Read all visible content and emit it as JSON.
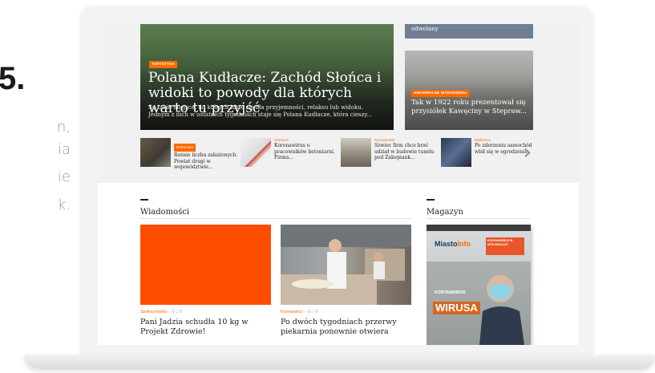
{
  "side_text": {
    "number": "5.",
    "lines": [
      "n,",
      "ia",
      "ie",
      "k."
    ]
  },
  "hero": {
    "badge": "TURYSTYKA",
    "title": "Polana Kudłacze: Zachód Słońca i widoki to powody dla których warto tu przyjść",
    "lead": "Są takie miejsce, do których idzie się dla przyjemności, relaksu lub widoku. Jednym z nich w ostatnich tygodniach staje się Polana Kudłacze, która cieszy..."
  },
  "side_top": {
    "title": "odwołany"
  },
  "side_card": {
    "badge": "ARCHIWALNE WYDARZENIA",
    "title": "Tak w 1922 roku prezentował się przysiółek Kawęciny w Stepraw..."
  },
  "strip": [
    {
      "category": "Rolnictwo",
      "title": "Rośnie liczba zakażonych. Powiat drugi w województwie..."
    },
    {
      "category": "Ostrzyce",
      "title": "Koronawirus u pracowników betoniarni. Firma..."
    },
    {
      "category": "Kryczanowie",
      "title": "Szwiec firm chce brać udział w budowie tunelu pod Zakopiank..."
    },
    {
      "category": "Myślenice",
      "title": "Po zderzeniu samochód wbił się w ogrodzenie"
    }
  ],
  "sections": {
    "news_title": "Wiadomości",
    "magazine_title": "Magazyn"
  },
  "news": [
    {
      "category": "Społeczeństwo",
      "counts": "○ 0  ◇ 0",
      "title": "Pani Jadzia schudła 10 kg w Projekt Zdrowie!"
    },
    {
      "category": "Koronawirus",
      "counts": "○ 0  ◇ 0",
      "title": "Po dwóch tygodniach przerwy piekarnia ponownie otwiera"
    }
  ],
  "magazine": {
    "logo_a": "Miasto",
    "logo_b": "Info",
    "box_text": "KORONAWIRUS W MYŚLENICACH",
    "headline": "KORONAWIRUS",
    "big": "WIRUSA"
  },
  "colors": {
    "accent": "#ff6a00",
    "orange_block": "#ff4d00",
    "text_dark": "#222222"
  }
}
